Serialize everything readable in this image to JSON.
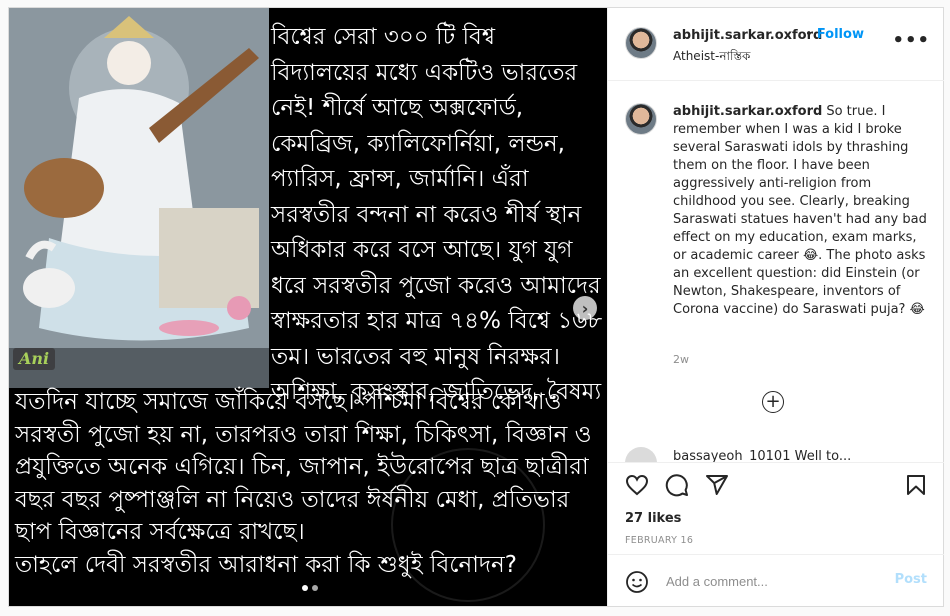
{
  "post": {
    "media": {
      "stamp_text": "Ani",
      "text_block_top": "বিশ্বের সেরা ৩০০ টি বিশ্ব\nবিদ্যালয়ের মধ্যে একটিও ভারতের\nনেই! শীর্ষে আছে অক্সফোর্ড,\nকেমব্রিজ, ক্যালিফোর্নিয়া, লন্ডন,\nপ্যারিস, ফ্রান্স, জার্মানি। এঁরা\nসরস্বতীর বন্দনা না করেও শীর্ষ স্থান\nঅধিকার করে বসে আছে। যুগ যুগ\nধরে সরস্বতীর পুজো করেও আমাদের\nস্বাক্ষরতার হার মাত্র ৭৪% বিশ্বে ১৬৮\nতম। ভারতের বহু মানুষ নিরক্ষর।\nঅশিক্ষা, কুসংস্কার, জাতিভেদ, বৈষম্য",
      "text_block_bottom": "যতদিন যাচ্ছে সমাজে জাঁকিয়ে বসছে। পশ্চিমা বিশ্বের কোথাও\nসরস্বতী পুজো হয় না, তারপরও তারা শিক্ষা, চিকিৎসা, বিজ্ঞান ও\nপ্রযুক্তিতে অনেক এগিয়ে। চিন, জাপান, ইউরোপের ছাত্র ছাত্রীরা\nবছর বছর পুষ্পাঞ্জলি না নিয়েও তাদের ঈর্ষনীয় মেধা, প্রতিভার\nছাপ বিজ্ঞানের সর্বক্ষেত্রে রাখছে।\nতাহলে দেবী সরস্বতীর আরাধনা করা কি শুধুই বিনোদন?",
      "carousel_next_icon": "chevron-right-icon",
      "slides_total": 2,
      "slide_active": 1
    },
    "header": {
      "username": "abhijit.sarkar.oxford",
      "separator": "•",
      "follow_label": "Follow",
      "subtitle": "Atheist-নাস্তিক",
      "more_label": "•••"
    },
    "caption": {
      "username": "abhijit.sarkar.oxford",
      "text": "So true. I remember when I was a kid I broke several Saraswati idols by thrashing them on the floor. I have been aggressively anti-religion from childhood you see. Clearly, breaking Saraswati statues haven't had any bad effect on my education, exam marks, or academic career 😂. The photo asks an excellent question: did Einstein (or Newton, Shakespeare, inventors of Corona vaccine) do Saraswati puja? 😂",
      "time": "2w"
    },
    "load_more_icon": "plus-circle-icon",
    "cut_comment": "bassayeoh_10101 Well to...",
    "actions": {
      "likes": "27 likes",
      "date": "FEBRUARY 16"
    },
    "add_comment": {
      "placeholder": "Add a comment...",
      "post_label": "Post"
    },
    "colors": {
      "accent": "#0095f6",
      "post_disabled": "#b2dffc",
      "border": "#dbdbdb",
      "muted": "#8e8e8e"
    }
  }
}
